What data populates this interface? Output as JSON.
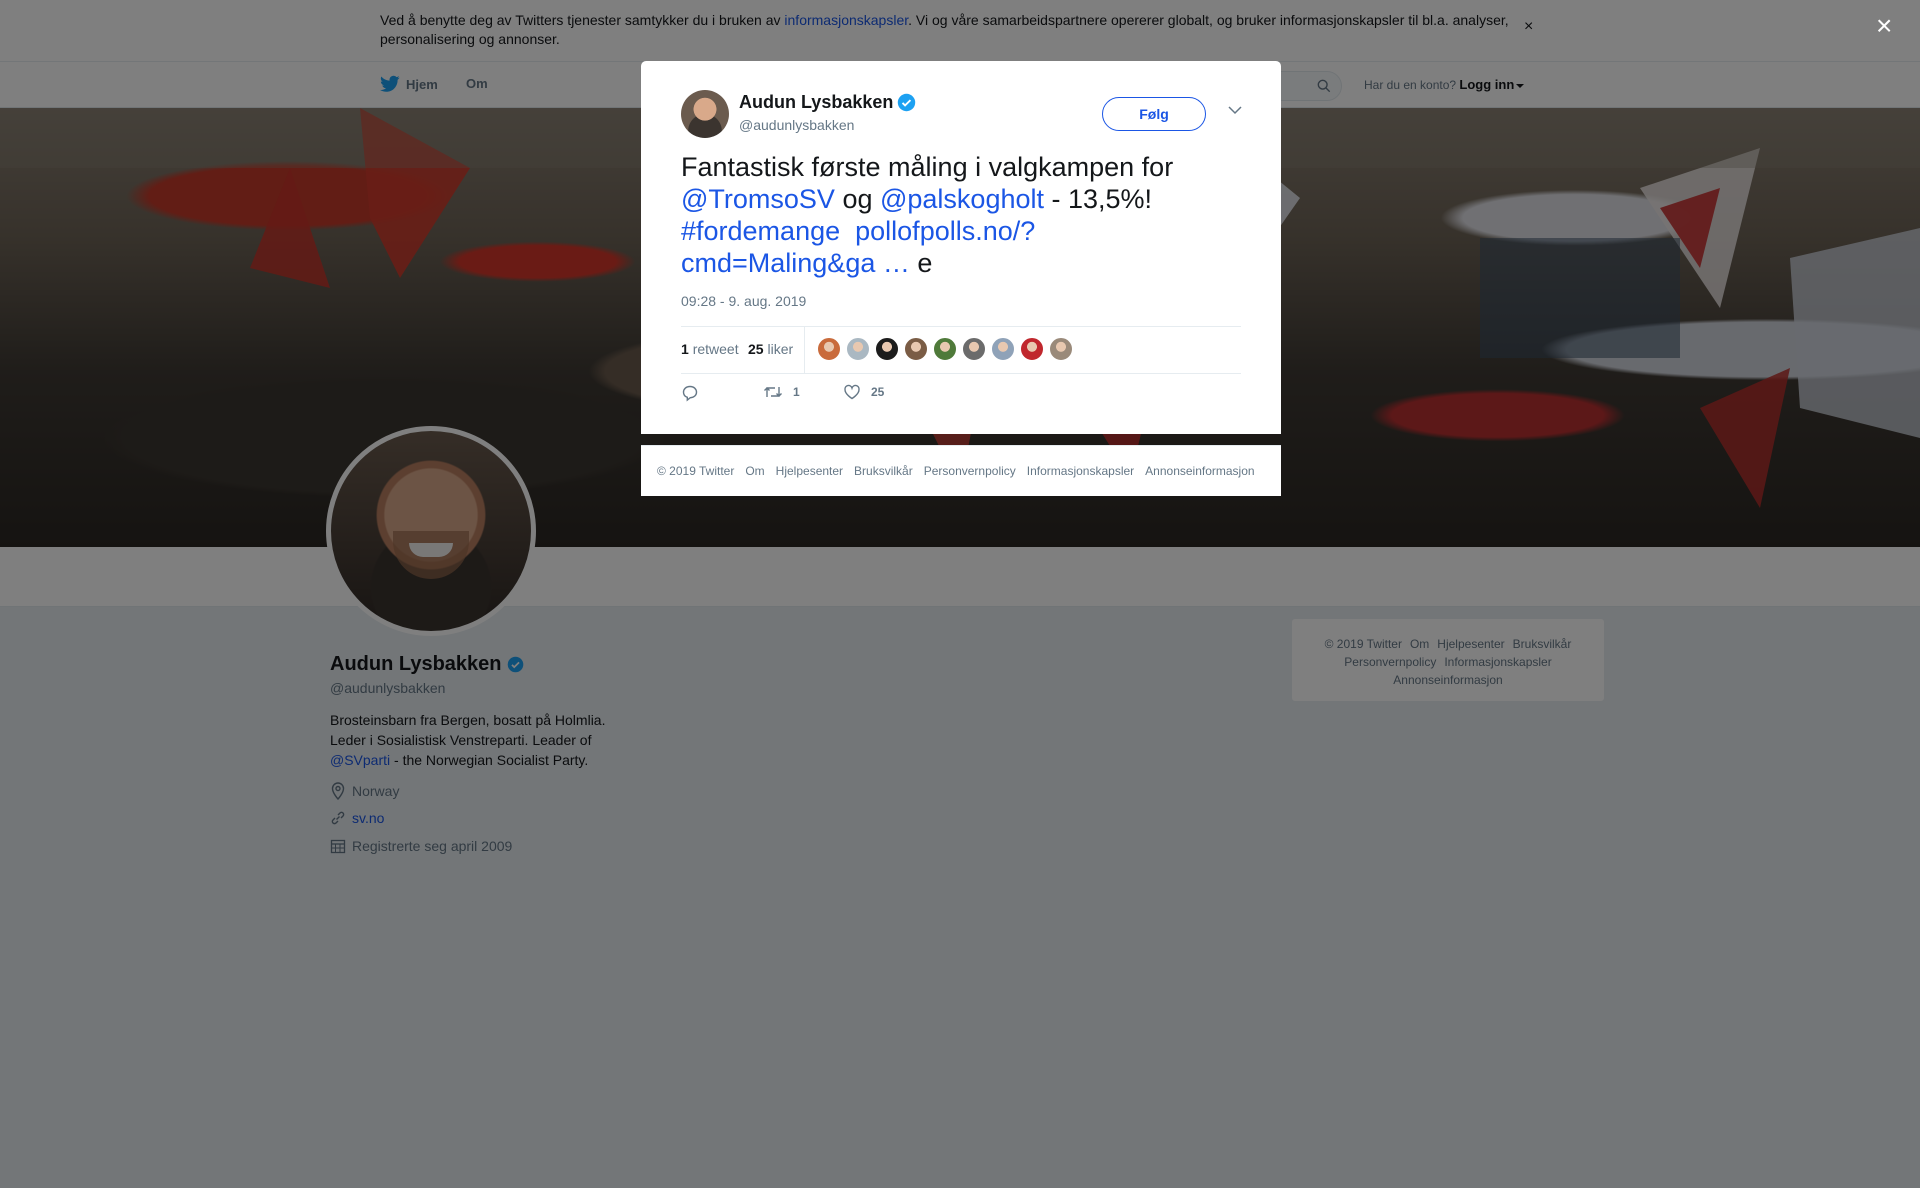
{
  "cookie_banner": {
    "text_before": "Ved å benytte deg av Twitters tjenester samtykker du i bruken av ",
    "link": "informasjonskapsler",
    "text_after": ". Vi og våre samarbeidspartnere opererer globalt, og bruker informasjonskapsler til bl.a. analyser, personalisering og annonser.",
    "close": "×"
  },
  "nav": {
    "home": "Hjem",
    "about": "Om",
    "account_prompt": "Har du en konto?",
    "login": "Logg inn"
  },
  "profile": {
    "name": "Audun Lysbakken",
    "handle": "@audunlysbakken",
    "bio_line1": "Brosteinsbarn fra Bergen, bosatt på Holmlia.",
    "bio_line2": "Leder i Sosialistisk Venstreparti. Leader of",
    "bio_mention": "@SVparti",
    "bio_line3": " - the Norwegian Socialist Party.",
    "location": "Norway",
    "website": "sv.no",
    "joined": "Registrerte seg april 2009"
  },
  "side_footer": {
    "items_row1": [
      "© 2019 Twitter",
      "Om",
      "Hjelpesenter",
      "Bruksvilkår"
    ],
    "items_row2": [
      "Personvernpolicy",
      "Informasjonskapsler"
    ],
    "items_row3": [
      "Annonseinformasjon"
    ]
  },
  "overlay_close": "×",
  "tweet": {
    "name": "Audun Lysbakken",
    "handle": "@audunlysbakken",
    "follow_label": "Følg",
    "text_1": "Fantastisk første måling i valgkampen for ",
    "mention_1": "@TromsoSV",
    "text_2": " og ",
    "mention_2": "@palskogholt",
    "text_3": " - 13,5%! ",
    "hashtag": "#fordemange",
    "link_1": "pollofpolls.no/?",
    "link_2": "cmd=Maling&ga …",
    "text_4": " e",
    "timestamp": "09:28 - 9. aug. 2019",
    "retweet_count": "1",
    "retweet_label": "retweet",
    "like_count": "25",
    "like_label": "liker",
    "action_retweets": "1",
    "action_likes": "25",
    "liker_face_colors": [
      "#c96b3c",
      "#aab8c2",
      "#1c1c1c",
      "#7a5c45",
      "#4f7a3a",
      "#6b6b6b",
      "#8fa2b8",
      "#c0272d",
      "#9a8a7a"
    ]
  },
  "modal_footer": [
    "© 2019 Twitter",
    "Om",
    "Hjelpesenter",
    "Bruksvilkår",
    "Personvernpolicy",
    "Informasjonskapsler",
    "Annonseinformasjon"
  ],
  "colors": {
    "accent": "#1b56e5",
    "verified": "#1da1f2",
    "muted": "#657786"
  }
}
